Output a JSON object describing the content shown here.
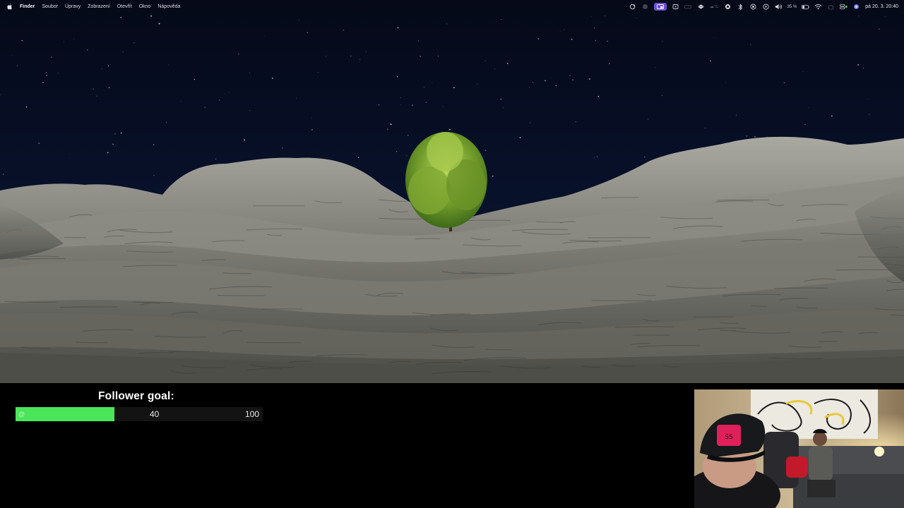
{
  "menubar": {
    "apple_icon": "apple-logo-icon",
    "app_name": "Finder",
    "menus": [
      "Soubor",
      "Úpravy",
      "Zobrazení",
      "Otevřít",
      "Okno",
      "Nápověda"
    ],
    "status": {
      "battery_percent": "35 %",
      "clock": "pá 20. 3.  20:40",
      "icons": [
        "sync-icon",
        "app-indicator-icon",
        "screen-mirror-icon",
        "window-icon",
        "notch-icon",
        "diamond-icon",
        "weather-icon",
        "record-icon",
        "bluetooth-icon",
        "focus-icon",
        "play-icon",
        "volume-icon",
        "wifi-icon",
        "share-icon",
        "control-center-icon",
        "siri-icon"
      ],
      "weather_text": "°C"
    }
  },
  "goal": {
    "title": "Follower goal:",
    "current": 40,
    "current_label": "40",
    "target": 100,
    "target_label": "100",
    "fill_text": "@",
    "bar_color": "#4be55a"
  },
  "wallpaper": {
    "description_icon": "night-landscape-wallpaper"
  },
  "webcam": {
    "feed_icon": "webcam-feed"
  }
}
